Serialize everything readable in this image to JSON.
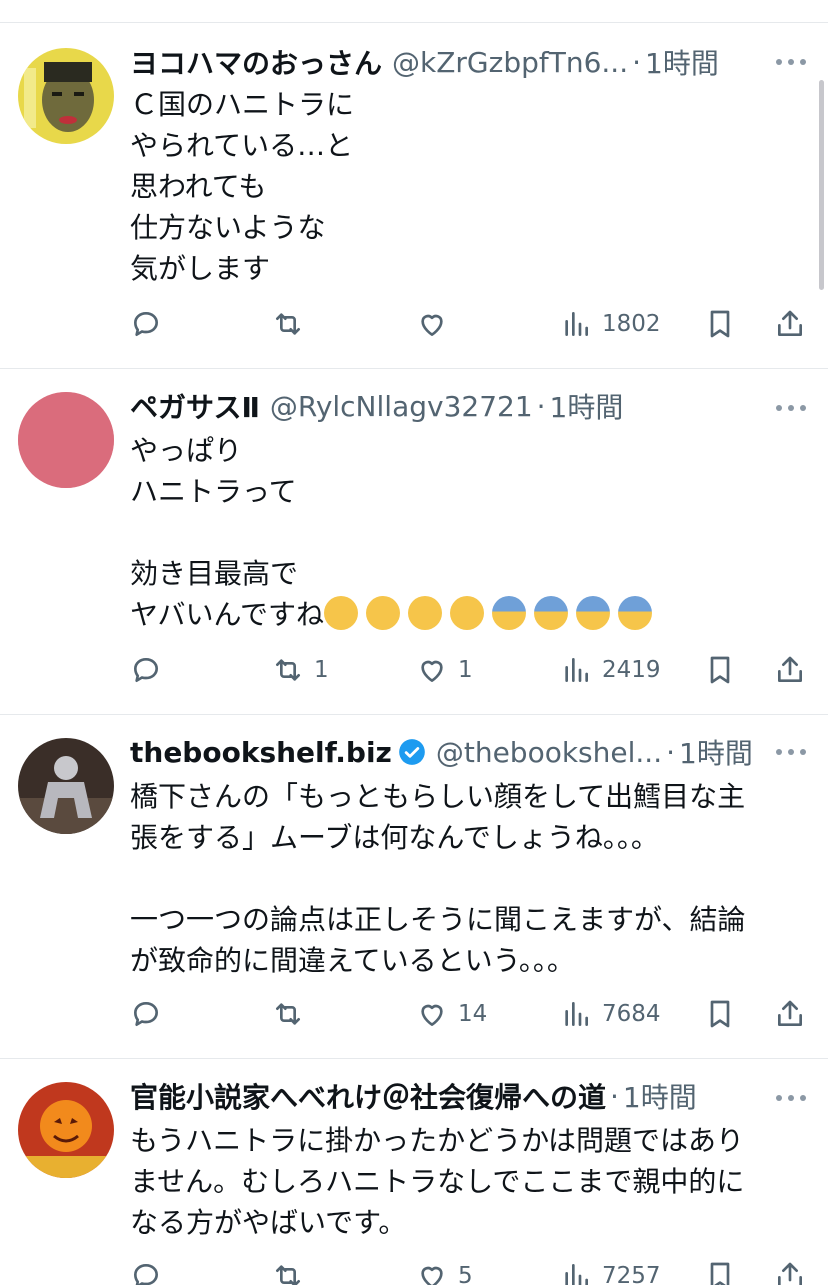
{
  "tweets": [
    {
      "name": "ヨコハマのおっさん",
      "handle": "@kZrGzbpfTn6...",
      "dot": "·",
      "time": "1時間",
      "text": "Ｃ国のハニトラに\nやられている…と\n思われても\n仕方ないような\n気がします",
      "emoji": [],
      "retweets": "",
      "likes": "",
      "views": "1802",
      "verified": false
    },
    {
      "name": "ペガサスⅡ",
      "handle": "@RylcNllagv32721",
      "dot": "·",
      "time": "1時間",
      "text": "やっぱり\nハニトラって\n\n効き目最高で\nヤバいんですね",
      "emoji": [
        "loudly-crying-face",
        "loudly-crying-face",
        "loudly-crying-face",
        "loudly-crying-face",
        "anxious-face-with-sweat",
        "anxious-face-with-sweat",
        "anxious-face-with-sweat",
        "anxious-face-with-sweat"
      ],
      "retweets": "1",
      "likes": "1",
      "views": "2419",
      "verified": false
    },
    {
      "name": "thebookshelf.biz",
      "handle": "@thebookshel...",
      "dot": "·",
      "time": "1時間",
      "text": "橋下さんの「もっともらしい顔をして出鱈目な主\n張をする」ムーブは何なんでしょうね。。。\n\n一つ一つの論点は正しそうに聞こえますが、結論\nが致命的に間違えているという。。。",
      "emoji": [],
      "retweets": "",
      "likes": "14",
      "views": "7684",
      "verified": true
    },
    {
      "name": "官能小説家へべれけ＠社会復帰への道",
      "handle": "",
      "dot": "·",
      "time": "1時間",
      "text": "もうハニトラに掛かったかどうかは問題ではあり\nません。むしろハニトラなしでここまで親中的に\nなる方がやばいです。",
      "emoji": [],
      "retweets": "",
      "likes": "5",
      "views": "7257",
      "verified": false
    }
  ],
  "colors": {
    "text": "#0f1419",
    "secondary": "#536471",
    "divider": "#e6e9ec",
    "verified": "#1d9bf0"
  }
}
